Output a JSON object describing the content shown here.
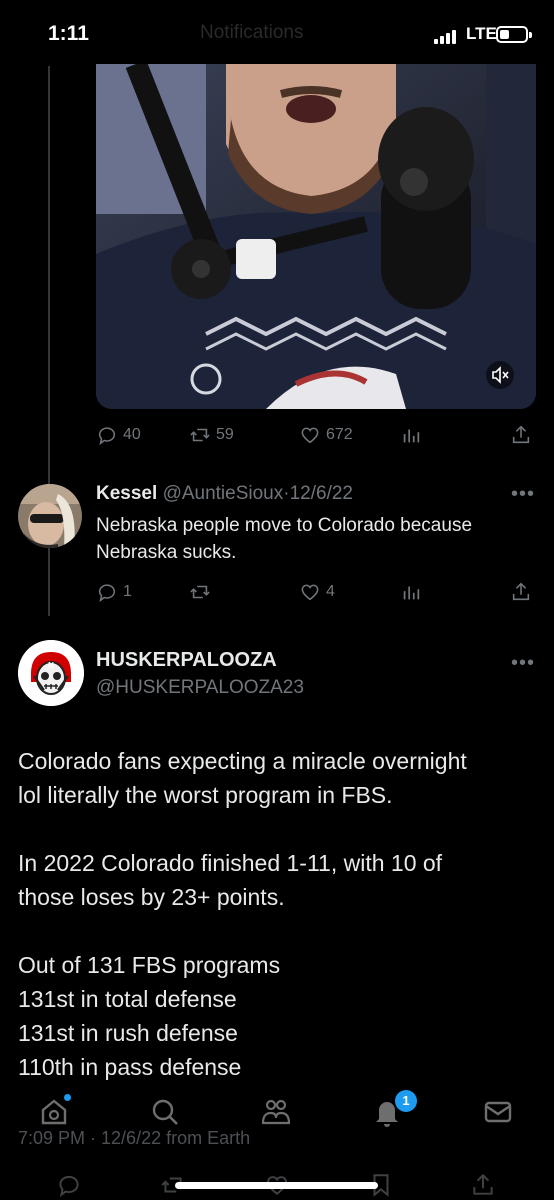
{
  "status_bar": {
    "time": "1:11",
    "faded_text": "Notifications",
    "network": "LTE"
  },
  "video": {
    "controls": {
      "mute_icon": "muted-speaker-icon"
    }
  },
  "main_tweet_actions": {
    "replies": "40",
    "retweets": "59",
    "likes": "672"
  },
  "reply": {
    "name": "Kessel",
    "handle": "@AuntieSioux",
    "separator": "·",
    "date": "12/6/22",
    "text": "Nebraska people move to Colorado because Nebraska sucks.",
    "actions": {
      "replies": "1",
      "retweets": "",
      "likes": "4"
    }
  },
  "tweet": {
    "name": "HUSKERPALOOZA",
    "handle": "@HUSKERPALOOZA23",
    "paragraphs": [
      [
        "Colorado fans expecting a miracle overnight",
        "lol literally the worst program in FBS."
      ],
      [
        "In 2022 Colorado finished 1-11, with 10 of",
        "those loses by 23+ points."
      ],
      [
        "Out of 131 FBS programs",
        "131st in total defense",
        "131st in rush defense",
        "110th in pass defense"
      ]
    ],
    "timestamp": "7:09 PM · 12/6/22 from Earth"
  },
  "nav": {
    "items": [
      "home-icon",
      "search-icon",
      "communities-icon",
      "notifications-icon",
      "messages-icon"
    ],
    "notification_count": "1"
  },
  "colors": {
    "background": "#000000",
    "text": "#e7e9ea",
    "muted": "#71767b",
    "accent": "#1d9bf0",
    "nebraska_red": "#d00000"
  }
}
